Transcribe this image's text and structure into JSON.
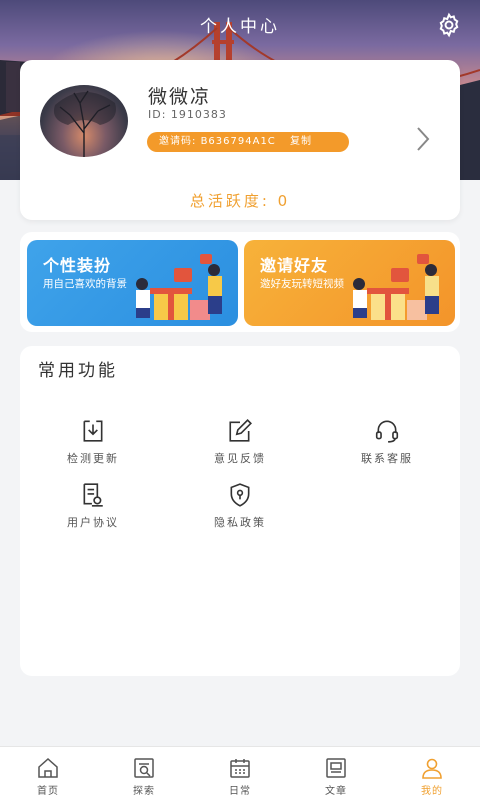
{
  "header": {
    "title": "个人中心",
    "settings_icon": "gear-icon"
  },
  "profile": {
    "nickname": "微微凉",
    "uid_text": "ID: 1910383",
    "invite_label": "邀请码:",
    "invite_code": "B636794A1C",
    "copy_label": "复制",
    "activity_text": "总活跃度: 0"
  },
  "promos": [
    {
      "title": "个性装扮",
      "subtitle": "用自己喜欢的背景",
      "color": "#2b8fe0"
    },
    {
      "title": "邀请好友",
      "subtitle": "邀好友玩转短视频",
      "color": "#f3942a"
    }
  ],
  "functions": {
    "title": "常用功能",
    "items": [
      {
        "label": "检测更新",
        "icon": "download-icon"
      },
      {
        "label": "意见反馈",
        "icon": "edit-icon"
      },
      {
        "label": "联系客服",
        "icon": "headset-icon"
      },
      {
        "label": "用户协议",
        "icon": "agreement-icon"
      },
      {
        "label": "隐私政策",
        "icon": "shield-lock-icon"
      }
    ]
  },
  "tabbar": {
    "items": [
      {
        "label": "首页",
        "icon": "home-icon"
      },
      {
        "label": "探索",
        "icon": "explore-icon"
      },
      {
        "label": "日常",
        "icon": "calendar-icon"
      },
      {
        "label": "文章",
        "icon": "article-icon"
      },
      {
        "label": "我的",
        "icon": "user-icon"
      }
    ],
    "active_index": 4,
    "active_color": "#f0a030"
  },
  "colors": {
    "accent": "#f39a2a",
    "activity": "#f0a030",
    "background": "#f3f4f6"
  }
}
